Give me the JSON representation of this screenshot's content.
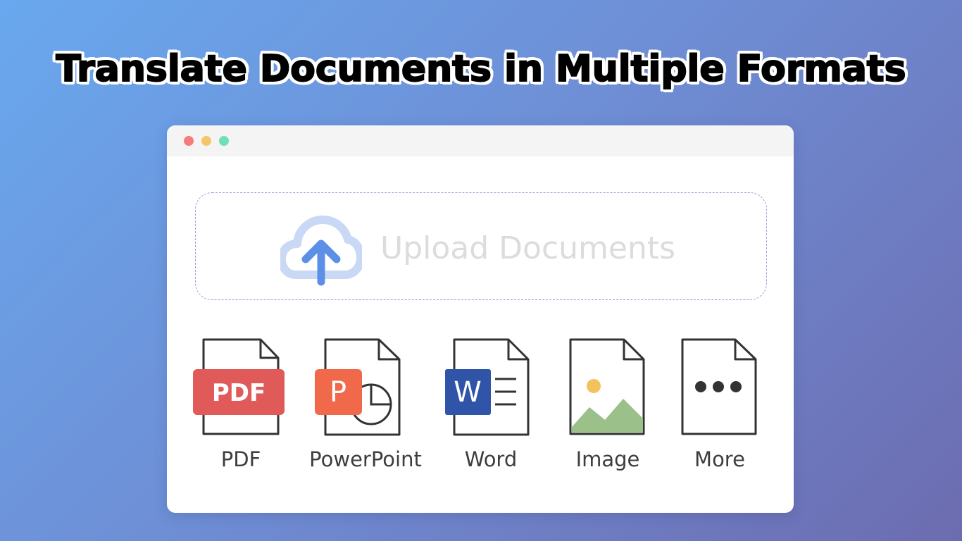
{
  "headline": "Translate Documents in Multiple Formats",
  "window": {
    "controls": [
      "close",
      "minimize",
      "maximize"
    ]
  },
  "upload": {
    "label": "Upload Documents",
    "icon": "cloud-upload-icon"
  },
  "formats": [
    {
      "label": "PDF",
      "icon": "pdf-file-icon",
      "badge": "PDF",
      "color": "#e05a5a"
    },
    {
      "label": "PowerPoint",
      "icon": "powerpoint-file-icon",
      "badge": "P",
      "color": "#f0694a"
    },
    {
      "label": "Word",
      "icon": "word-file-icon",
      "badge": "W",
      "color": "#2f54a8"
    },
    {
      "label": "Image",
      "icon": "image-file-icon",
      "color": "#9bc08a"
    },
    {
      "label": "More",
      "icon": "more-file-icon"
    }
  ],
  "colors": {
    "accent_blue": "#5b90e6",
    "cloud_light": "#c9d9f5",
    "dashed_border": "#a59be0"
  }
}
